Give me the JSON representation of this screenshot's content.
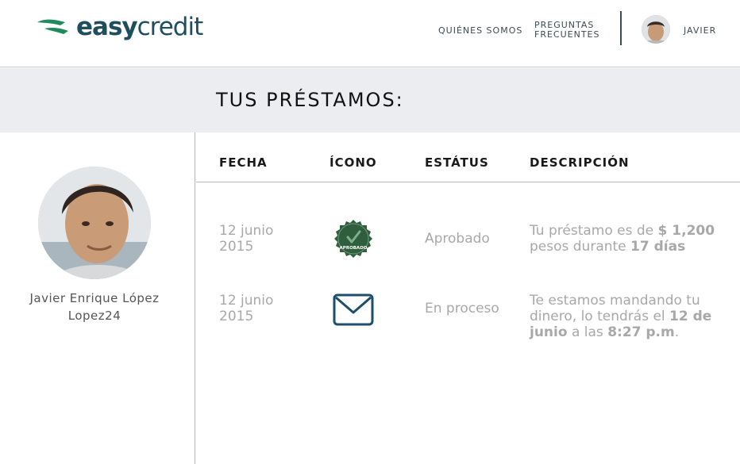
{
  "header": {
    "logo_easy": "easy",
    "logo_credit": "credit",
    "nav_about": "QUIÉNES SOMOS",
    "nav_faq": "PREGUNTAS FRECUENTES",
    "user_name": "JAVIER"
  },
  "page_title": "TUS PRÉSTAMOS:",
  "profile": {
    "name": "Javier Enrique López",
    "username": "Lopez24"
  },
  "table": {
    "headers": [
      "FECHA",
      "ÍCONO",
      "ESTÁTUS",
      "DESCRIPCIÓN"
    ],
    "rows": [
      {
        "date": "12 junio 2015",
        "icon": "approved-seal-icon",
        "icon_label": "APROBADO",
        "status": "Aprobado",
        "desc_1": "Tu préstamo es de ",
        "desc_amount": "$ 1,200",
        "desc_2": " pesos durante ",
        "desc_days": "17 días"
      },
      {
        "date": "12 junio 2015",
        "icon": "envelope-icon",
        "status": "En proceso",
        "desc_1": "Te estamos mandando tu dinero, lo tendrás el ",
        "desc_date": "12 de junio",
        "desc_2": " a las ",
        "desc_time": "8:27 p.m",
        "desc_3": "."
      }
    ]
  },
  "colors": {
    "brand_teal": "#1f4e5f",
    "brand_green": "#1f8a5a",
    "seal_green": "#2f5e3e",
    "envelope_blue": "#1d4e6b",
    "band_grey": "#ecedf0",
    "muted_text": "#a8a8a8"
  }
}
